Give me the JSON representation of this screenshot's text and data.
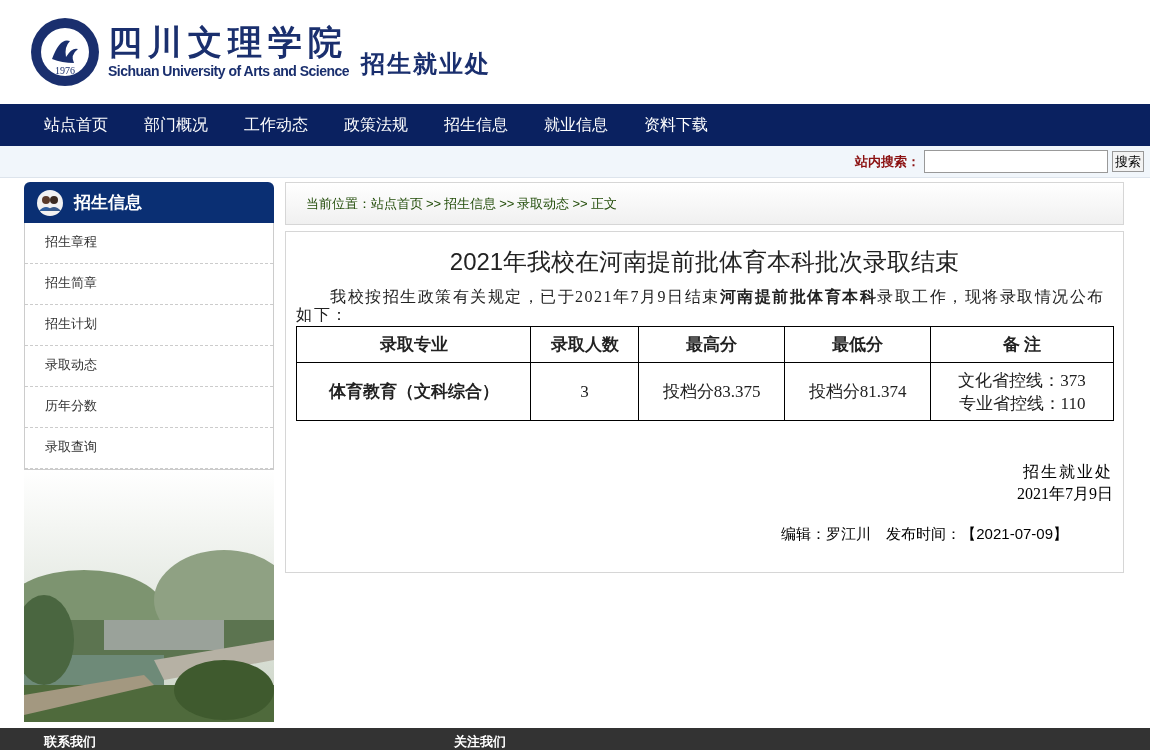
{
  "header": {
    "school_name": "四川文理学院",
    "school_name_en": "Sichuan University of Arts and Science",
    "department": "招生就业处",
    "emblem_year": "1976"
  },
  "nav": [
    {
      "label": "站点首页"
    },
    {
      "label": "部门概况"
    },
    {
      "label": "工作动态"
    },
    {
      "label": "政策法规"
    },
    {
      "label": "招生信息"
    },
    {
      "label": "就业信息"
    },
    {
      "label": "资料下载"
    }
  ],
  "search": {
    "label": "站内搜索：",
    "button": "搜索"
  },
  "sidebar": {
    "title": "招生信息",
    "items": [
      {
        "label": "招生章程"
      },
      {
        "label": "招生简章"
      },
      {
        "label": "招生计划"
      },
      {
        "label": "录取动态"
      },
      {
        "label": "历年分数"
      },
      {
        "label": "录取查询"
      }
    ]
  },
  "breadcrumb": {
    "label": "当前位置：",
    "items": [
      "站点首页",
      "招生信息",
      "录取动态",
      "正文"
    ],
    "separator": ">>"
  },
  "article": {
    "title": "2021年我校在河南提前批体育本科批次录取结束",
    "paragraph": "我校按招生政策有关规定，已于2021年7月9日结束**河南提前批体育本科**录取工作，现将录取情况公布如下：",
    "table": {
      "columns": [
        "录取专业",
        "录取人数",
        "最高分",
        "最低分",
        "备 注"
      ],
      "rows": [
        {
          "cells": [
            "体育教育（文科综合）",
            "3",
            "投档分83.375",
            "投档分81.374"
          ],
          "notes": [
            "文化省控线：373",
            "专业省控线：110"
          ]
        }
      ]
    },
    "signature": "招生就业处",
    "date": "2021年7月9日",
    "meta": "编辑：罗江川　发布时间：【2021-07-09】"
  },
  "footer": [
    "联系我们",
    "关注我们"
  ]
}
